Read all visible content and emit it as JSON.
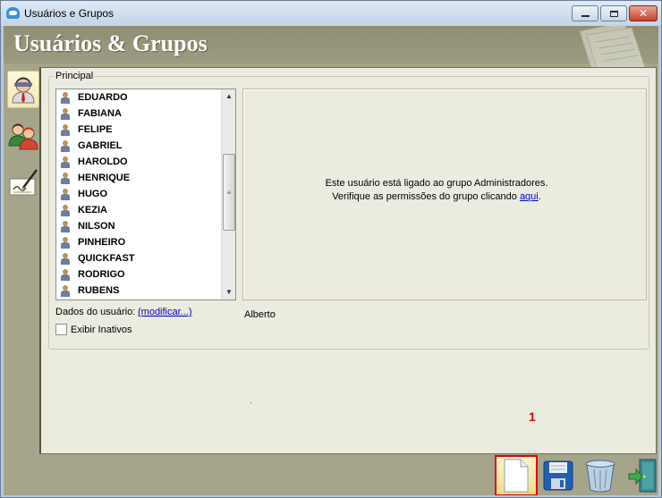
{
  "window": {
    "title": "Usuários e Grupos"
  },
  "header": {
    "title": "Usuários & Grupos"
  },
  "sidebar": {
    "icons": [
      "user-icon",
      "group-icon",
      "signature-icon"
    ]
  },
  "group": {
    "label": "Principal"
  },
  "users": [
    "EDUARDO",
    "FABIANA",
    "FELIPE",
    "GABRIEL",
    "HAROLDO",
    "HENRIQUE",
    "HUGO",
    "KEZIA",
    "NILSON",
    "PINHEIRO",
    "QUICKFAST",
    "RODRIGO",
    "RUBENS"
  ],
  "info": {
    "line1": "Este usuário está ligado ao grupo Administradores.",
    "line2_prefix": "Verifique as permissões do grupo clicando ",
    "line2_link": "aqui",
    "line2_suffix": "."
  },
  "dados": {
    "label": "Dados do usuário:",
    "link": "(modificar...)"
  },
  "selected_user": "Alberto",
  "checkbox": {
    "label": "Exibir Inativos",
    "checked": false
  },
  "toolbar": {
    "icons": [
      "new-document-icon",
      "save-icon",
      "trash-icon",
      "exit-door-icon"
    ]
  },
  "annotation": "1"
}
